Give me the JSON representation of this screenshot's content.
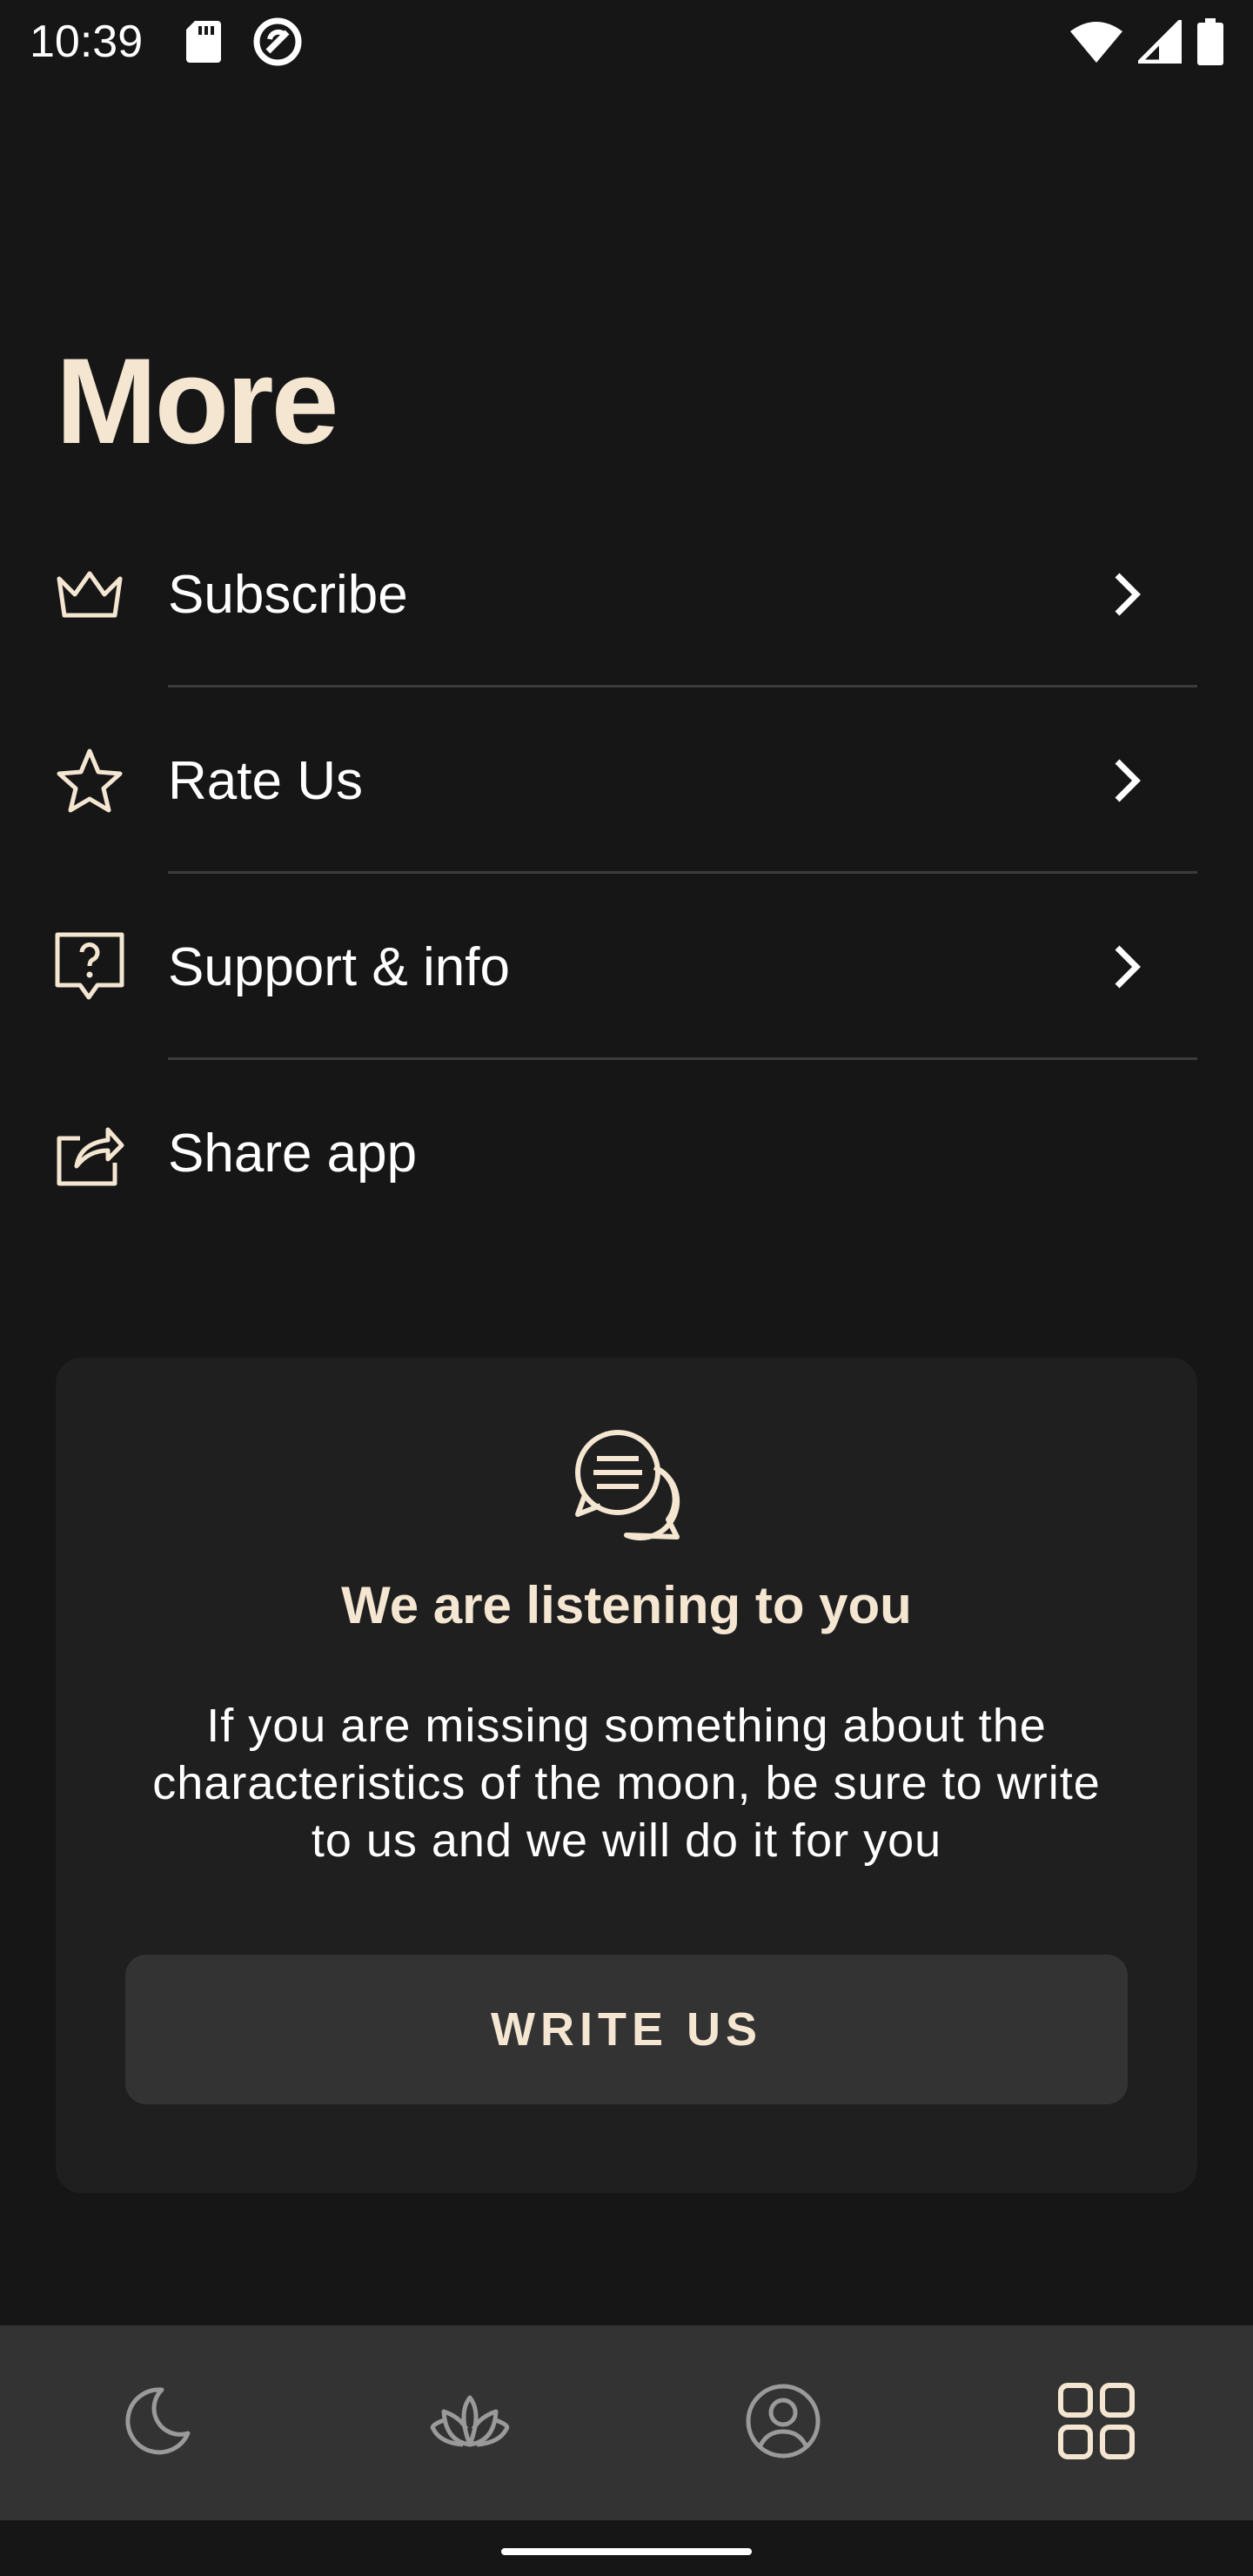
{
  "status_bar": {
    "time": "10:39",
    "left_icons": [
      "sd-card-icon",
      "vpn-icon"
    ],
    "right_icons": [
      "wifi-icon",
      "signal-icon",
      "battery-icon"
    ]
  },
  "page": {
    "title": "More"
  },
  "menu": {
    "items": [
      {
        "label": "Subscribe",
        "icon": "crown-icon",
        "has_chevron": true
      },
      {
        "label": "Rate Us",
        "icon": "star-icon",
        "has_chevron": true
      },
      {
        "label": "Support & info",
        "icon": "help-bubble-icon",
        "has_chevron": true
      },
      {
        "label": "Share app",
        "icon": "share-icon",
        "has_chevron": false
      }
    ]
  },
  "feedback_card": {
    "icon": "chat-bubbles-icon",
    "title": "We are listening to you",
    "body": "If you are missing something about the characteristics of the moon, be sure to write to us and we will do it for you",
    "button_label": "WRITE US"
  },
  "bottom_nav": {
    "items": [
      {
        "icon": "moon-icon",
        "active": false
      },
      {
        "icon": "lotus-icon",
        "active": false
      },
      {
        "icon": "profile-icon",
        "active": false
      },
      {
        "icon": "grid-icon",
        "active": true
      }
    ]
  },
  "colors": {
    "background": "#161617",
    "accent": "#f4e6d1",
    "card": "#1f1f20",
    "button": "#333334",
    "nav_bar": "#333334",
    "icon_inactive": "#9a9a9a"
  }
}
